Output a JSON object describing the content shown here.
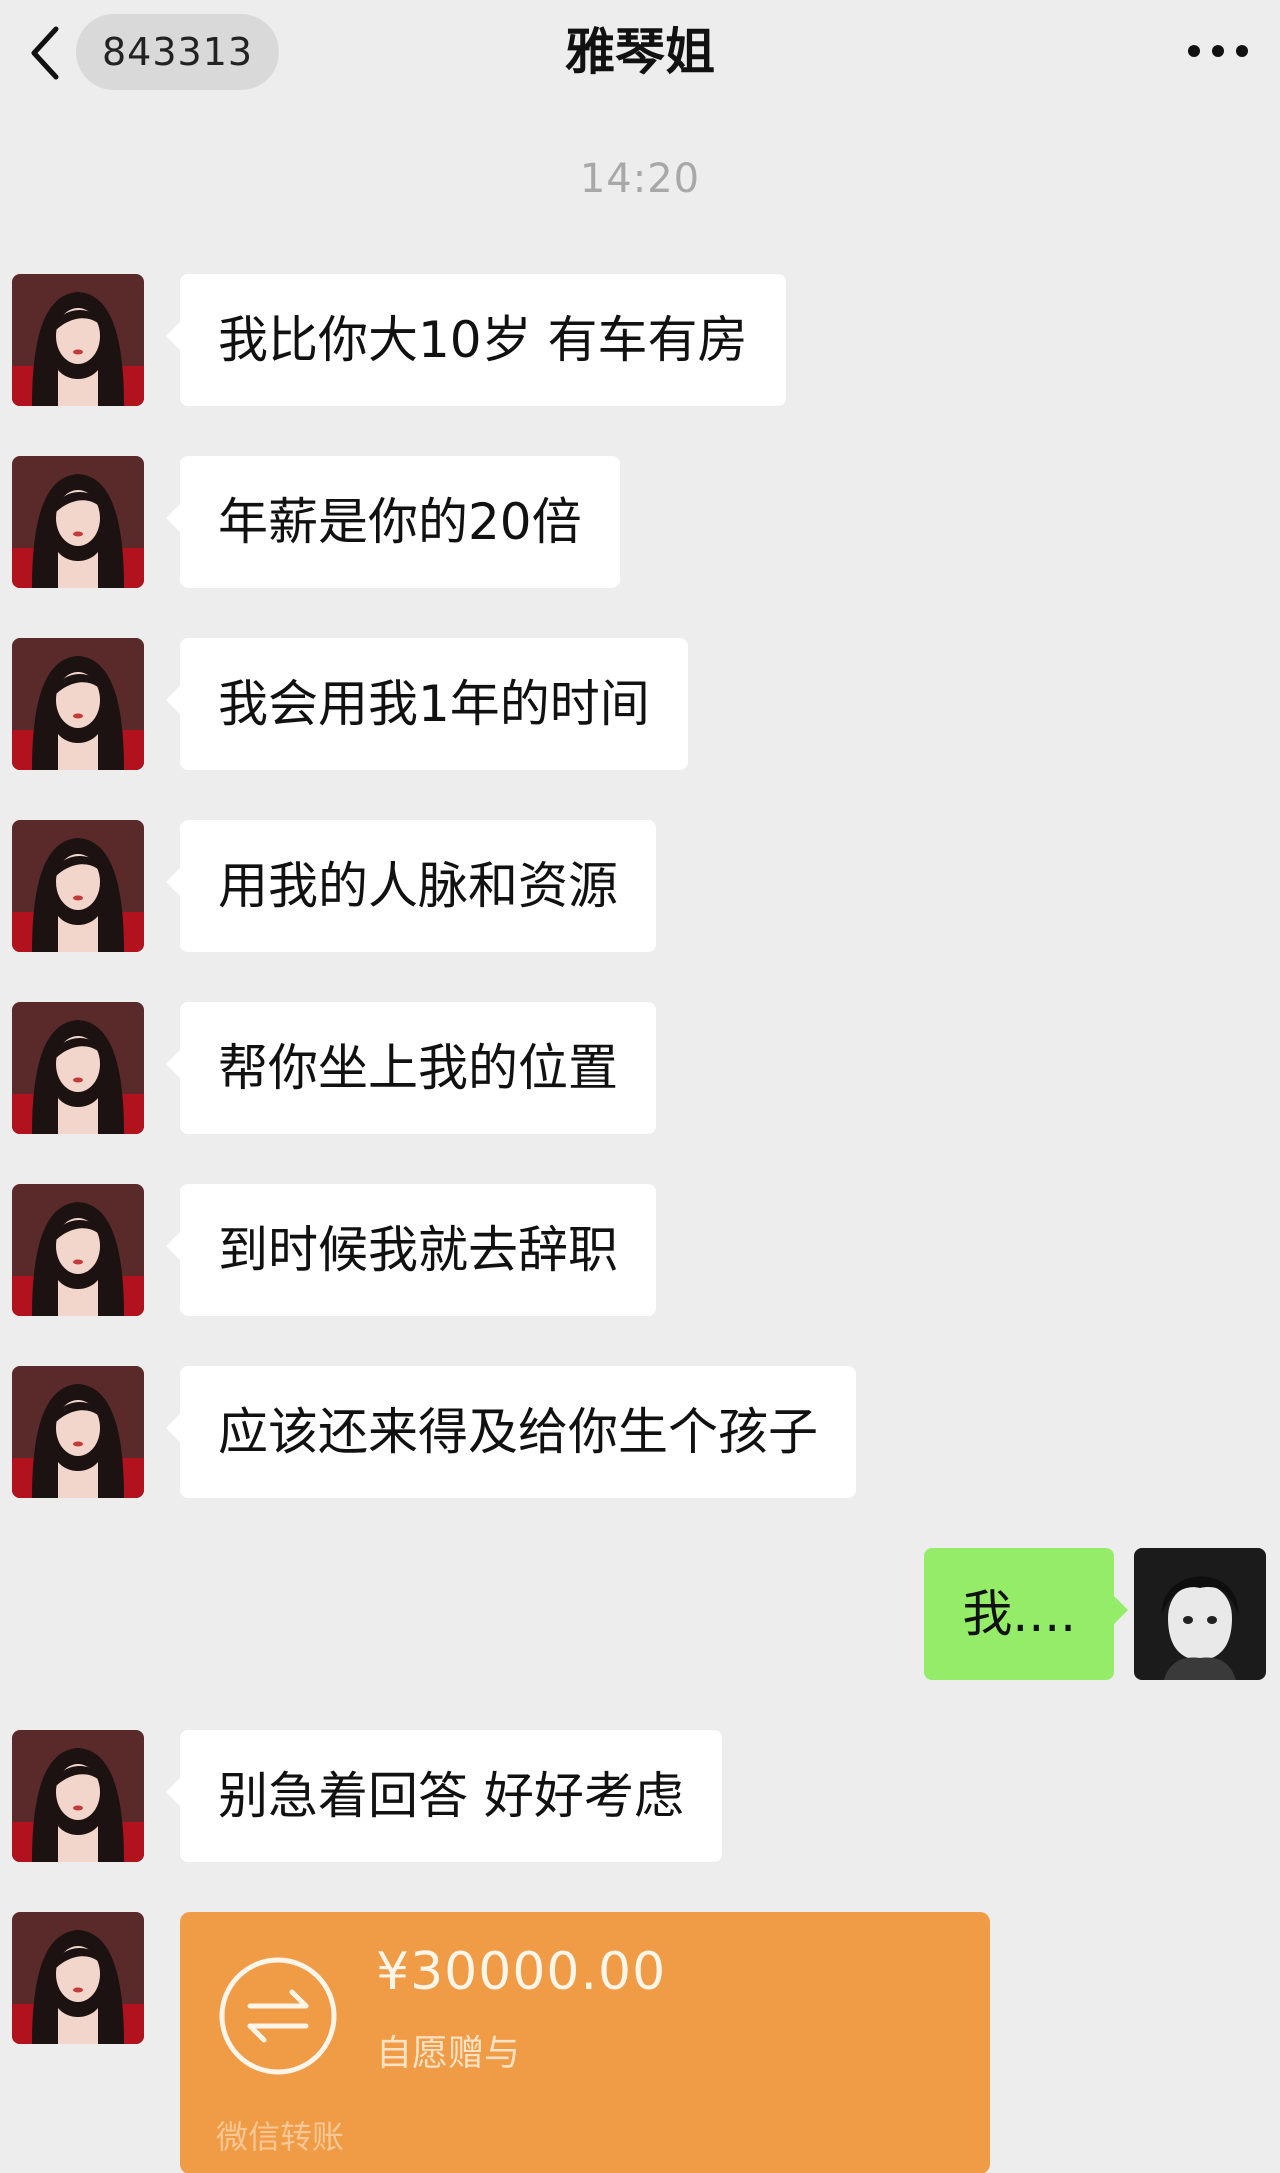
{
  "header": {
    "unread_count": "843313",
    "title": "雅琴姐",
    "back_icon": "chevron-left-icon",
    "more_icon": "more-dots-icon"
  },
  "timestamp": "14:20",
  "messages": [
    {
      "side": "left",
      "text": "我比你大10岁 有车有房"
    },
    {
      "side": "left",
      "text": "年薪是你的20倍"
    },
    {
      "side": "left",
      "text": "我会用我1年的时间"
    },
    {
      "side": "left",
      "text": "用我的人脉和资源"
    },
    {
      "side": "left",
      "text": "帮你坐上我的位置"
    },
    {
      "side": "left",
      "text": "到时候我就去辞职"
    },
    {
      "side": "left",
      "text": "应该还来得及给你生个孩子"
    },
    {
      "side": "right",
      "text": "我...."
    },
    {
      "side": "left",
      "text": "别急着回答 好好考虑"
    }
  ],
  "transfer": {
    "amount": "¥30000.00",
    "note": "自愿赠与",
    "footer": "微信转账",
    "icon": "transfer-arrows-icon"
  },
  "colors": {
    "background": "#ededed",
    "incoming_bubble": "#ffffff",
    "outgoing_bubble": "#95ec69",
    "transfer_card": "#f09b45",
    "timestamp": "#a8a8a8"
  }
}
